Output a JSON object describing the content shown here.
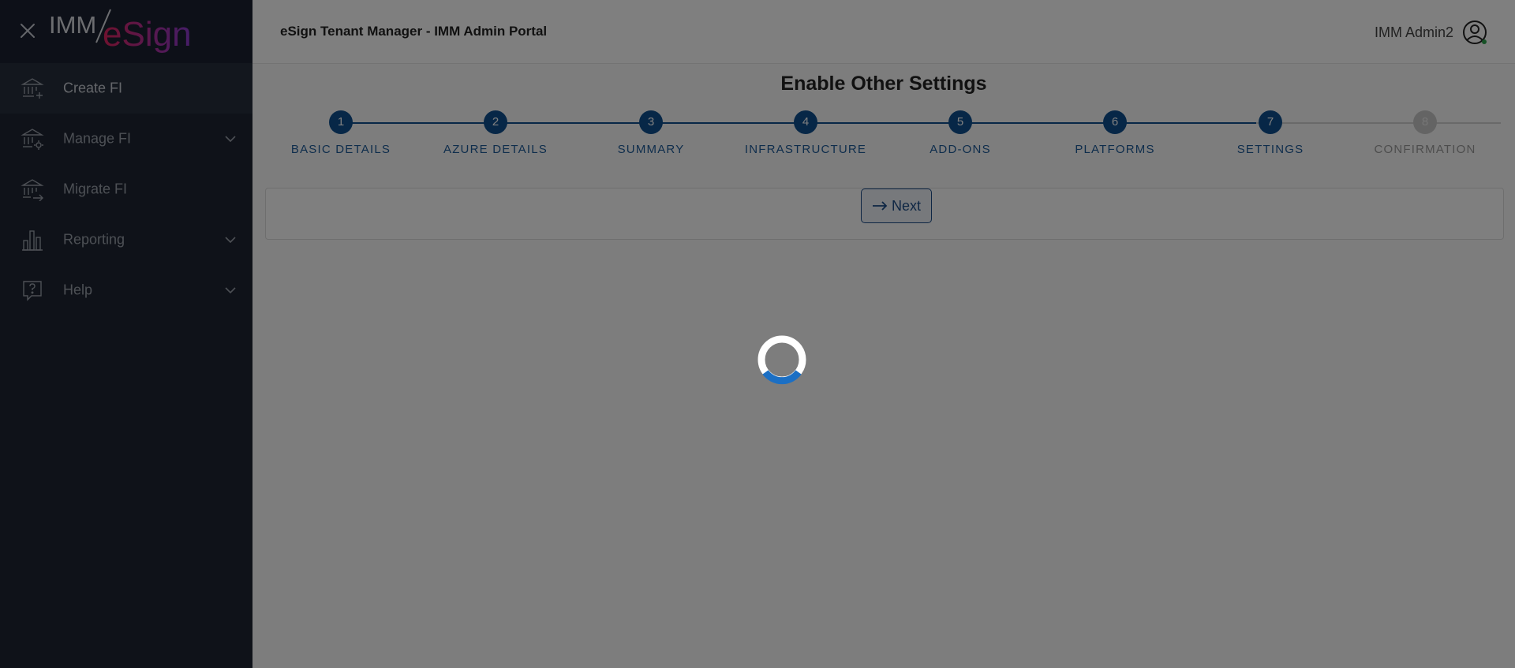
{
  "colors": {
    "sidebar_bg": "#1e2533",
    "accent": "#0e4f8f",
    "step_pending": "#c9c9c9",
    "spinner_ring": "#ffffff",
    "spinner_arc": "#1b6fc4"
  },
  "sidebar": {
    "close_icon": "close-icon",
    "logo": {
      "part1": "IMM",
      "part2": "eSign"
    },
    "items": [
      {
        "label": "Create FI",
        "icon": "bank-plus-icon",
        "active": true,
        "has_chevron": false
      },
      {
        "label": "Manage FI",
        "icon": "bank-gear-icon",
        "active": false,
        "has_chevron": true
      },
      {
        "label": "Migrate FI",
        "icon": "bank-arrow-icon",
        "active": false,
        "has_chevron": false
      },
      {
        "label": "Reporting",
        "icon": "bar-chart-icon",
        "active": false,
        "has_chevron": true
      },
      {
        "label": "Help",
        "icon": "help-bubble-icon",
        "active": false,
        "has_chevron": true
      }
    ]
  },
  "header": {
    "title": "eSign Tenant Manager - IMM Admin Portal",
    "user_name": "IMM Admin2",
    "user_icon": "user-circle-icon"
  },
  "main": {
    "page_title": "Enable Other Settings",
    "steps": [
      {
        "number": "1",
        "label": "BASIC DETAILS",
        "state": "done"
      },
      {
        "number": "2",
        "label": "AZURE DETAILS",
        "state": "done"
      },
      {
        "number": "3",
        "label": "SUMMARY",
        "state": "done"
      },
      {
        "number": "4",
        "label": "INFRASTRUCTURE",
        "state": "done"
      },
      {
        "number": "5",
        "label": "ADD-ONS",
        "state": "done"
      },
      {
        "number": "6",
        "label": "PLATFORMS",
        "state": "done"
      },
      {
        "number": "7",
        "label": "SETTINGS",
        "state": "current"
      },
      {
        "number": "8",
        "label": "CONFIRMATION",
        "state": "pending"
      }
    ],
    "next_button": {
      "label": "Next",
      "icon": "arrow-right-icon"
    }
  },
  "overlay": {
    "loading": true,
    "spinner_icon": "loading-spinner-icon"
  }
}
